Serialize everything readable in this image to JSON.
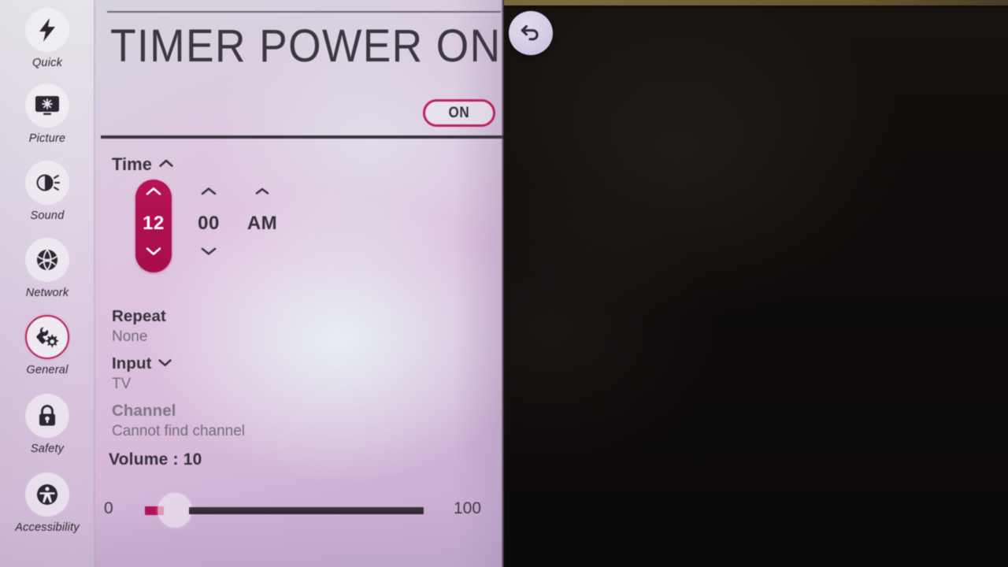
{
  "sidebar": {
    "items": [
      {
        "label": "Quick",
        "icon": "lightning-icon",
        "selected": false
      },
      {
        "label": "Picture",
        "icon": "display-icon",
        "selected": false
      },
      {
        "label": "Sound",
        "icon": "speaker-icon",
        "selected": false
      },
      {
        "label": "Network",
        "icon": "globe-icon",
        "selected": false
      },
      {
        "label": "General",
        "icon": "wrench-gear-icon",
        "selected": true
      },
      {
        "label": "Safety",
        "icon": "lock-icon",
        "selected": false
      },
      {
        "label": "Accessibility",
        "icon": "accessibility-icon",
        "selected": false
      }
    ]
  },
  "main": {
    "title": "TIMER POWER ON",
    "toggle": {
      "label": "ON",
      "state": "on"
    },
    "time_section": {
      "label": "Time",
      "expand_icon": "chevron-up-icon",
      "hour": {
        "value": "12",
        "selected": true,
        "up_icon": "chevron-up-icon",
        "down_icon": "chevron-down-icon"
      },
      "minute": {
        "value": "00",
        "selected": false,
        "up_icon": "chevron-up-icon",
        "down_icon": "chevron-down-icon"
      },
      "ampm": {
        "value": "AM",
        "selected": false,
        "up_icon": "chevron-up-icon"
      }
    },
    "repeat": {
      "title": "Repeat",
      "value": "None"
    },
    "input": {
      "title": "Input",
      "value": "TV",
      "expand_icon": "chevron-down-icon"
    },
    "channel": {
      "title": "Channel",
      "value": "Cannot find channel",
      "disabled": true
    },
    "volume": {
      "label": "Volume : 10",
      "value": 10,
      "min_label": "0",
      "max_label": "100"
    }
  },
  "back_button": {
    "icon": "back-arrow-icon"
  },
  "colors": {
    "accent": "#b01353",
    "accent_border": "#bd2160",
    "text_primary": "#35303a",
    "text_secondary": "#746d7a",
    "text_disabled": "#7d7683",
    "panel_light": "#e8f2f4",
    "panel_lavender": "#cfb2d6",
    "backdrop": "#0c0a09",
    "top_strip": "#7e6a3c"
  }
}
